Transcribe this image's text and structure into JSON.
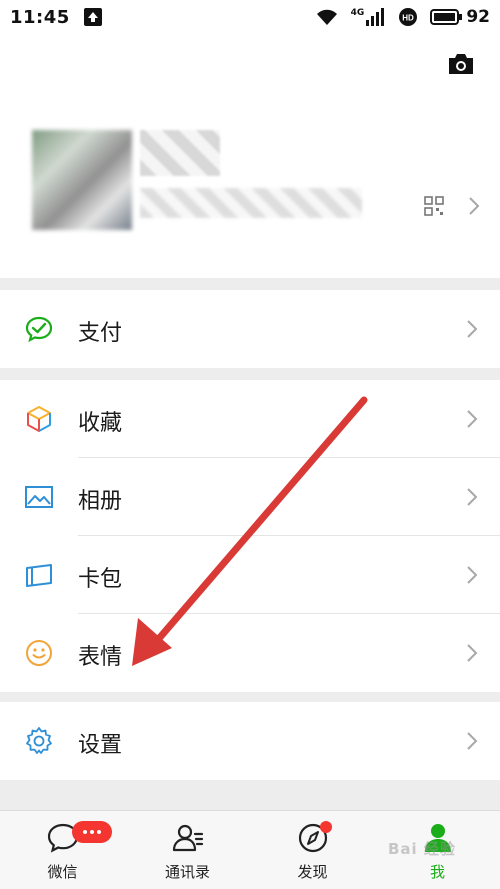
{
  "status_bar": {
    "time": "11:45",
    "network": "4G",
    "battery": "92"
  },
  "profile": {
    "avatar_obscured": true,
    "name_obscured": true
  },
  "menu": {
    "pay": {
      "label": "支付",
      "icon": "wechat-pay-icon"
    },
    "favorites": {
      "label": "收藏",
      "icon": "cube-icon"
    },
    "album": {
      "label": "相册",
      "icon": "image-icon"
    },
    "cards": {
      "label": "卡包",
      "icon": "card-icon"
    },
    "stickers": {
      "label": "表情",
      "icon": "smiley-icon"
    },
    "settings": {
      "label": "设置",
      "icon": "gear-icon"
    }
  },
  "tabbar": {
    "tabs": [
      {
        "label": "微信",
        "icon": "chat-icon"
      },
      {
        "label": "通讯录",
        "icon": "contacts-icon"
      },
      {
        "label": "发现",
        "icon": "compass-icon"
      },
      {
        "label": "我",
        "icon": "person-icon"
      }
    ],
    "active": "我",
    "chat_badge": "..."
  },
  "colors": {
    "accent": "#1aad19",
    "badge": "#f43530",
    "annotation_arrow": "#d93a35"
  },
  "watermark": "Bai 经验"
}
